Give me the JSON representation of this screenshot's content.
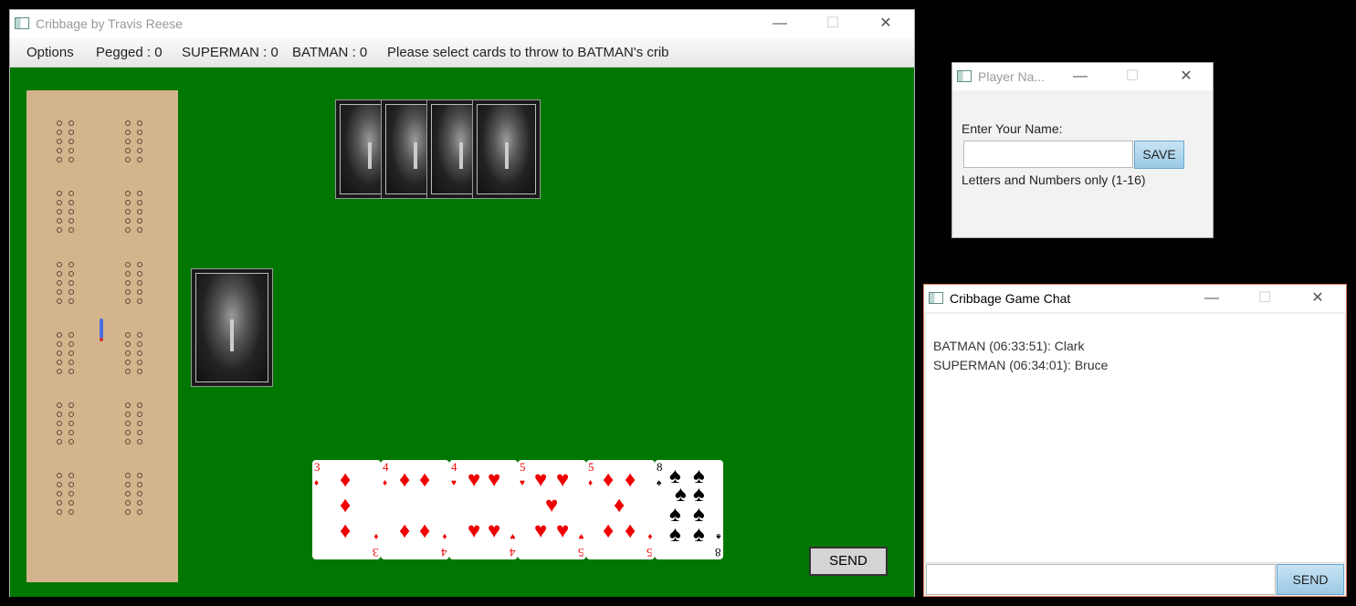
{
  "main_window": {
    "title": "Cribbage by Travis Reese",
    "controls": {
      "minimize": "—",
      "maximize": "☐",
      "close": "✕"
    },
    "menubar": {
      "options": "Options",
      "pegged": "Pegged : 0",
      "player1_score": "SUPERMAN : 0",
      "player2_score": "BATMAN : 0",
      "status": "Please select cards to throw to BATMAN's crib"
    },
    "table_color": "#007700",
    "board_color": "#d3b48c",
    "opponent_hand_count": 4,
    "player_hand": [
      {
        "rank": "3",
        "suit": "♦",
        "color": "red"
      },
      {
        "rank": "4",
        "suit": "♦",
        "color": "red"
      },
      {
        "rank": "4",
        "suit": "♥",
        "color": "red"
      },
      {
        "rank": "5",
        "suit": "♥",
        "color": "red"
      },
      {
        "rank": "5",
        "suit": "♦",
        "color": "red"
      },
      {
        "rank": "8",
        "suit": "♠",
        "color": "black"
      }
    ],
    "send_label": "SEND"
  },
  "player_name_window": {
    "title": "Player Na...",
    "prompt": "Enter Your Name:",
    "input_value": "",
    "save_label": "SAVE",
    "hint": "Letters and Numbers only (1-16)"
  },
  "chat_window": {
    "title": "Cribbage Game Chat",
    "messages": [
      "BATMAN (06:33:51): Clark",
      "SUPERMAN (06:34:01): Bruce"
    ],
    "input_value": "",
    "send_label": "SEND"
  }
}
